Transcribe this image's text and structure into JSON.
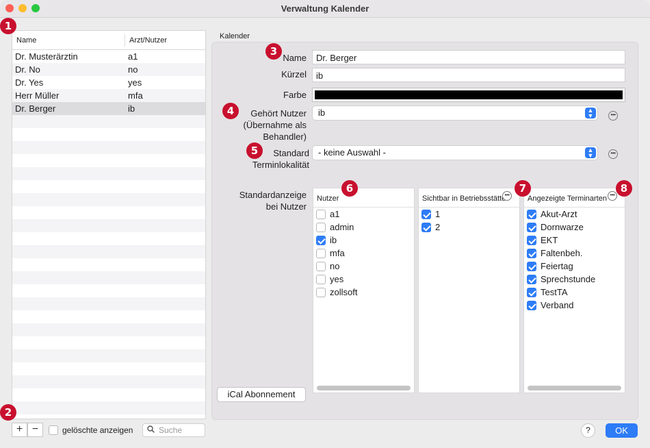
{
  "window": {
    "title": "Verwaltung Kalender"
  },
  "badges": [
    "1",
    "2",
    "3",
    "4",
    "5",
    "6",
    "7",
    "8"
  ],
  "list": {
    "headers": [
      "Name",
      "Arzt/Nutzer"
    ],
    "rows": [
      {
        "name": "Dr. Musterärztin",
        "user": "a1"
      },
      {
        "name": "Dr. No",
        "user": "no"
      },
      {
        "name": "Dr. Yes",
        "user": "yes"
      },
      {
        "name": "Herr Müller",
        "user": "mfa"
      },
      {
        "name": "Dr. Berger",
        "user": "ib",
        "selected": true
      }
    ]
  },
  "bottom": {
    "add": "+",
    "remove": "−",
    "show_deleted": "gelöschte anzeigen",
    "search_placeholder": "Suche"
  },
  "group_label": "Kalender",
  "form": {
    "name_label": "Name",
    "name_value": "Dr. Berger",
    "short_label": "Kürzel",
    "short_value": "ib",
    "color_label": "Farbe",
    "color_value": "#000000",
    "owner_label_1": "Gehört Nutzer",
    "owner_label_2": "(Übernahme als",
    "owner_label_3": "Behandler)",
    "owner_value": "ib",
    "location_label_1": "Standard",
    "location_label_2": "Terminlokalität",
    "location_value": "- keine Auswahl -",
    "display_label_1": "Standardanzeige",
    "display_label_2": "bei Nutzer"
  },
  "tables": {
    "users": {
      "header": "Nutzer",
      "items": [
        {
          "label": "a1",
          "checked": false
        },
        {
          "label": "admin",
          "checked": false
        },
        {
          "label": "ib",
          "checked": true
        },
        {
          "label": "mfa",
          "checked": false
        },
        {
          "label": "no",
          "checked": false
        },
        {
          "label": "yes",
          "checked": false
        },
        {
          "label": "zollsoft",
          "checked": false
        }
      ]
    },
    "sites": {
      "header": "Sichtbar in Betriebsstätte",
      "items": [
        {
          "label": "1",
          "checked": true
        },
        {
          "label": "2",
          "checked": true
        }
      ]
    },
    "types": {
      "header": "Angezeigte Terminarten",
      "items": [
        {
          "label": "Akut-Arzt",
          "checked": true
        },
        {
          "label": "Dornwarze",
          "checked": true
        },
        {
          "label": "EKT",
          "checked": true
        },
        {
          "label": "Faltenbeh.",
          "checked": true
        },
        {
          "label": "Feiertag",
          "checked": true
        },
        {
          "label": "Sprechstunde",
          "checked": true
        },
        {
          "label": "TestTA",
          "checked": true
        },
        {
          "label": "Verband",
          "checked": true
        }
      ]
    }
  },
  "buttons": {
    "ical": "iCal Abonnement",
    "help": "?",
    "ok": "OK"
  },
  "icons": {
    "more": "ellipsis-circle-icon",
    "popup": "popup-arrows-icon",
    "search": "magnifier-icon"
  },
  "colors": {
    "accent": "#2e7cf6",
    "badge": "#c8102e"
  }
}
